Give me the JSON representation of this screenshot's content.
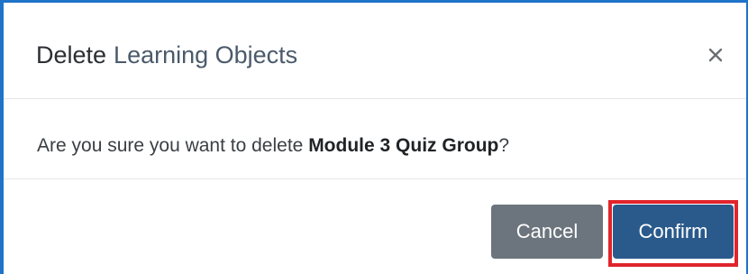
{
  "dialog": {
    "title_prefix": "Delete",
    "title_object": "Learning Objects",
    "close_glyph": "×",
    "question_prefix": "Are you sure you want to delete ",
    "item_name": "Module 3 Quiz Group",
    "question_suffix": "?"
  },
  "buttons": {
    "cancel_label": "Cancel",
    "confirm_label": "Confirm"
  },
  "icons": {
    "close": "close-icon"
  },
  "colors": {
    "frame": "#1f73c8",
    "cancel_bg": "#6c757d",
    "confirm_bg": "#2a5a8c",
    "highlight": "#e0242c"
  }
}
